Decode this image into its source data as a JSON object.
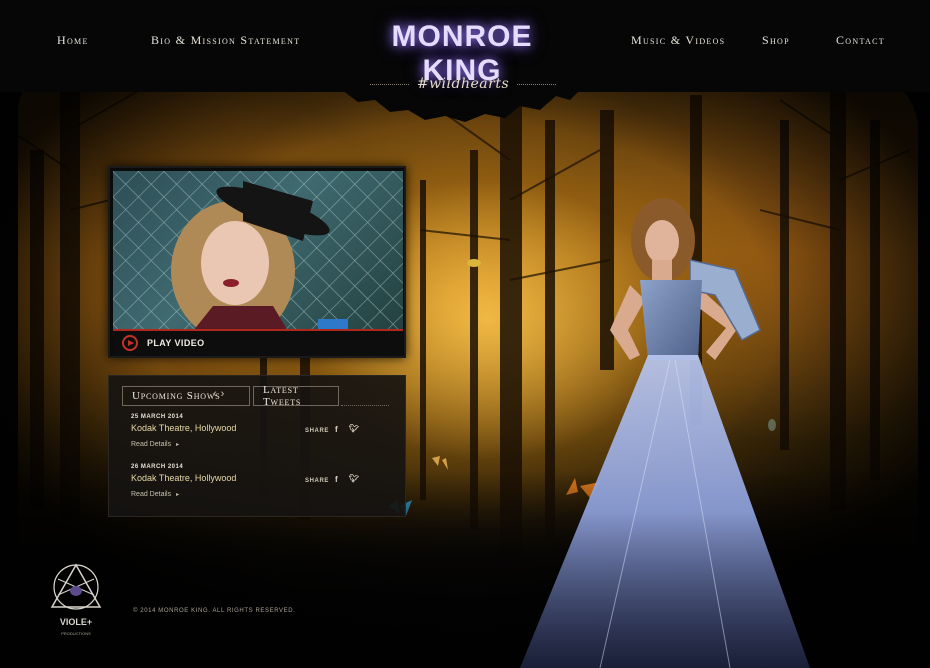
{
  "brand": {
    "name": "MONROE KING",
    "hashtag": "#wildhearts"
  },
  "nav": {
    "left": [
      {
        "label": "Home"
      },
      {
        "label": "Bio & Mission Statement"
      }
    ],
    "right": [
      {
        "label": "Music & Videos"
      },
      {
        "label": "Shop"
      },
      {
        "label": "Contact"
      }
    ]
  },
  "video": {
    "play_label": "PLAY VIDEO"
  },
  "shows_panel": {
    "tabs": [
      {
        "label": "Upcoming Shows"
      },
      {
        "label": "Latest Tweets"
      }
    ],
    "arrows": {
      "prev": "‹",
      "next": "›"
    },
    "shows": [
      {
        "date": "25 MARCH 2014",
        "venue": "Kodak Theatre, Hollywood",
        "more_label": "Read Details",
        "share_label": "SHARE"
      },
      {
        "date": "26 MARCH 2014",
        "venue": "Kodak Theatre, Hollywood",
        "more_label": "Read Details",
        "share_label": "SHARE"
      }
    ]
  },
  "footer": {
    "copyright": "© 2014 MONROE KING. ALL RIGHTS RESERVED.",
    "logo_text_line1": "VIOLE+",
    "logo_text_line2": "PRODUCTIONS"
  },
  "colors": {
    "brand_glow": "#b49cff",
    "play_accent": "#c23326",
    "venue_text": "#e5d8a8",
    "background": "#050505"
  },
  "icons": [
    "play-circle-icon",
    "facebook-icon",
    "twitter-icon",
    "chevron-left-icon",
    "chevron-right-icon",
    "triangle-logo-icon"
  ]
}
